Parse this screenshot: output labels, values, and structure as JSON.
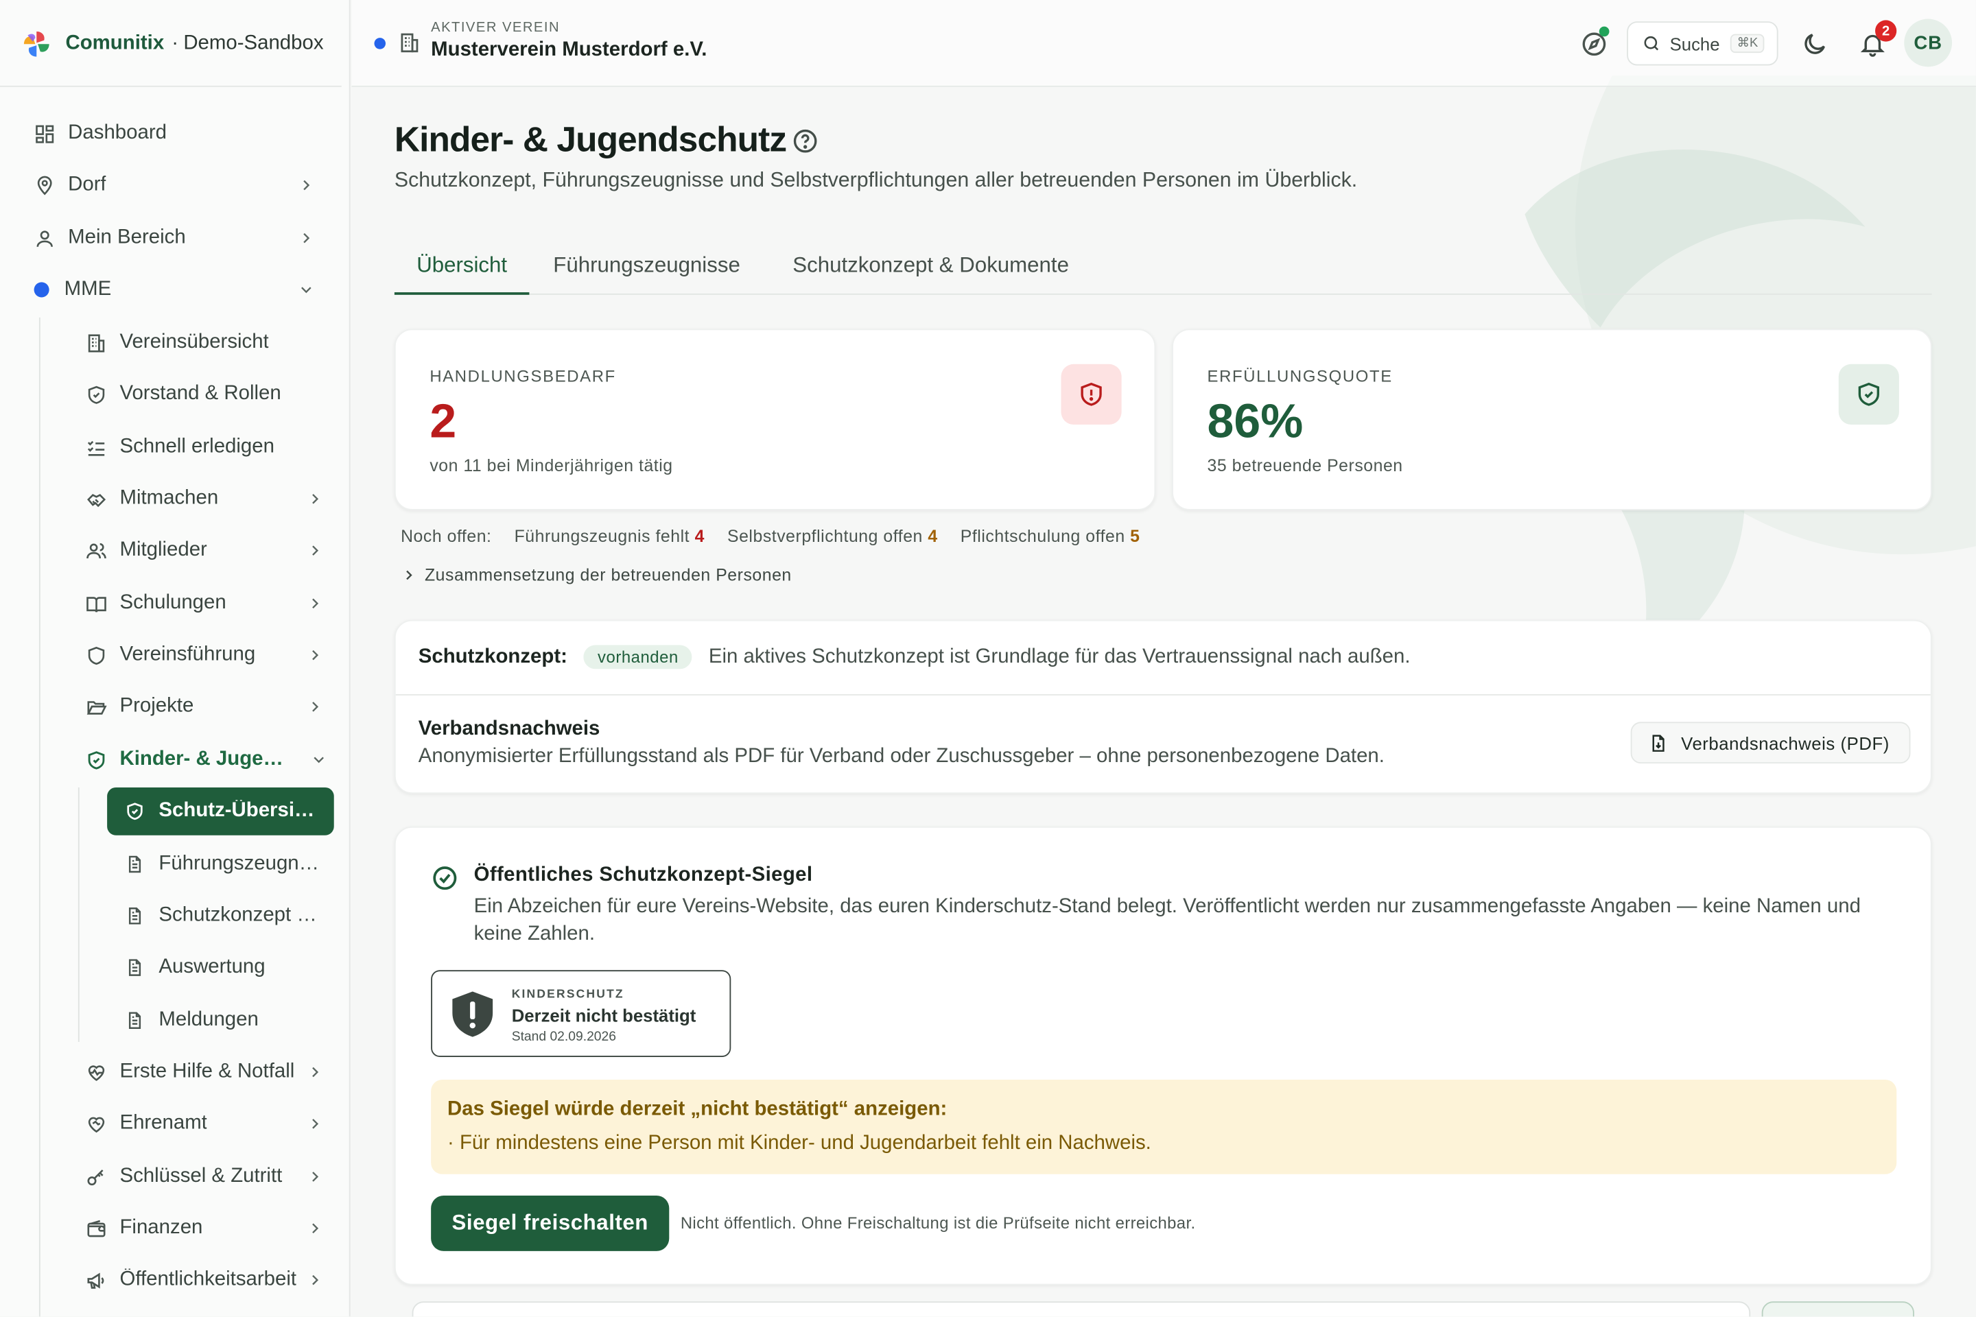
{
  "brand": {
    "name": "Comunitix",
    "separator": "·",
    "sandbox": "Demo-Sandbox"
  },
  "topbar": {
    "kicker": "AKTIVER VEREIN",
    "club": "Musterverein Musterdorf e.V.",
    "search_label": "Suche",
    "search_shortcut": "⌘K",
    "notification_count": "2",
    "avatar_initials": "CB"
  },
  "sidebar": {
    "items": [
      {
        "label": "Dashboard"
      },
      {
        "label": "Dorf"
      },
      {
        "label": "Mein Bereich"
      },
      {
        "label": "MME"
      },
      {
        "label": "Vereinsübersicht"
      },
      {
        "label": "Vorstand & Rollen"
      },
      {
        "label": "Schnell erledigen"
      },
      {
        "label": "Mitmachen"
      },
      {
        "label": "Mitglieder"
      },
      {
        "label": "Schulungen"
      },
      {
        "label": "Vereinsführung"
      },
      {
        "label": "Projekte"
      },
      {
        "label": "Kinder- & Jugendschutz"
      },
      {
        "label": "Schutz-Übersicht"
      },
      {
        "label": "Führungszeugnisse"
      },
      {
        "label": "Schutzkonzept & Dokumente"
      },
      {
        "label": "Auswertung"
      },
      {
        "label": "Meldungen"
      },
      {
        "label": "Erste Hilfe & Notfall"
      },
      {
        "label": "Ehrenamt"
      },
      {
        "label": "Schlüssel & Zutritt"
      },
      {
        "label": "Finanzen"
      },
      {
        "label": "Öffentlichkeitsarbeit"
      }
    ]
  },
  "page": {
    "title": "Kinder- & Jugendschutz",
    "subtitle": "Schutzkonzept, Führungszeugnisse und Selbstverpflichtungen aller betreuenden Personen im Überblick.",
    "tabs": [
      {
        "label": "Übersicht"
      },
      {
        "label": "Führungszeugnisse"
      },
      {
        "label": "Schutzkonzept & Dokumente"
      }
    ]
  },
  "stats": {
    "action": {
      "kicker": "HANDLUNGSBEDARF",
      "value": "2",
      "note": "von 11 bei Minderjährigen tätig"
    },
    "quota": {
      "kicker": "ERFÜLLUNGSQUOTE",
      "value": "86%",
      "note": "35 betreuende Personen"
    }
  },
  "open": {
    "label": "Noch offen:",
    "items": [
      {
        "label": "Führungszeugnis fehlt",
        "count": "4",
        "color": "#b91c1c"
      },
      {
        "label": "Selbstverpflichtung offen",
        "count": "4",
        "color": "#a16207"
      },
      {
        "label": "Pflichtschulung offen",
        "count": "5",
        "color": "#a16207"
      }
    ],
    "composition": "Zusammensetzung der betreuenden Personen"
  },
  "concept": {
    "label": "Schutzkonzept:",
    "status": "vorhanden",
    "text": "Ein aktives Schutzkonzept ist Grundlage für das Vertrauenssignal nach außen.",
    "proof_title": "Verbandsnachweis",
    "proof_text": "Anonymisierter Erfüllungsstand als PDF für Verband oder Zuschussgeber – ohne personenbezogene Daten.",
    "proof_button": "Verbandsnachweis (PDF)"
  },
  "seal": {
    "title": "Öffentliches Schutzkonzept-Siegel",
    "description": "Ein Abzeichen für eure Vereins-Website, das euren Kinderschutz-Stand belegt. Veröffentlicht werden nur zusammengefasste Angaben — keine Namen und keine Zahlen.",
    "badge_kicker": "KINDERSCHUTZ",
    "badge_status": "Derzeit nicht bestätigt",
    "badge_date": "Stand 02.09.2026",
    "warning_title": "Das Siegel würde derzeit „nicht bestätigt“ anzeigen:",
    "warning_item": "· Für mindestens eine Person mit Kinder- und Jugendarbeit fehlt ein Nachweis.",
    "button": "Siegel freischalten",
    "hint": "Nicht öffentlich. Ohne Freischaltung ist die Prüfseite nicht erreichbar."
  },
  "colors": {
    "brand": "#1f5d3b",
    "danger": "#b91c1c",
    "warning_bg": "#fdf3d8",
    "warning_text": "#7a5a05",
    "dot": "#2563eb"
  }
}
